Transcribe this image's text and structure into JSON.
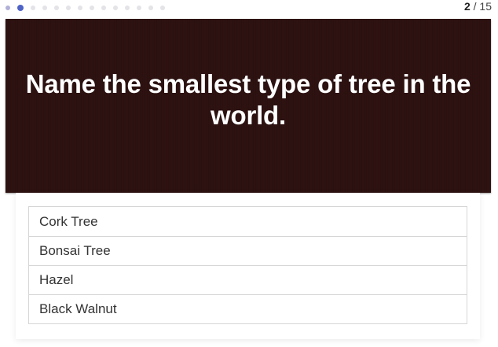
{
  "progress": {
    "current": "2",
    "separator": "/",
    "total": "15",
    "dot_count": 14,
    "active_index": 1,
    "dot_colors": {
      "done": "#b0b0d8",
      "active": "#4f63c6",
      "pending": "#e4e4e8"
    }
  },
  "question": {
    "text": "Name the smallest type of tree in the world.",
    "background": "#2d1211"
  },
  "answers": [
    {
      "label": "Cork Tree"
    },
    {
      "label": "Bonsai Tree"
    },
    {
      "label": "Hazel"
    },
    {
      "label": "Black Walnut"
    }
  ]
}
